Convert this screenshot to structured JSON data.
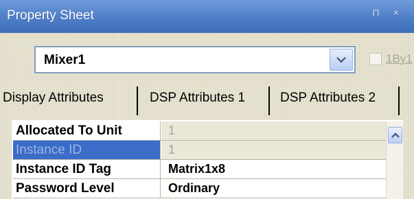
{
  "window": {
    "title": "Property Sheet",
    "title_buttons": [
      "⊓",
      "×"
    ]
  },
  "object_selector": {
    "value": "Mixer1",
    "dropdown_icon": "chevron-down-icon"
  },
  "one_by_one": {
    "label": "1By1",
    "checked": false,
    "enabled": false
  },
  "tabs": [
    {
      "label": "Display Attributes"
    },
    {
      "label": "DSP Attributes 1"
    },
    {
      "label": "DSP Attributes 2"
    }
  ],
  "properties": [
    {
      "name": "Allocated To Unit",
      "value": "1",
      "state": "readonly"
    },
    {
      "name": "Instance ID",
      "value": "1",
      "state": "selected-readonly"
    },
    {
      "name": "Instance ID Tag",
      "value": "Matrix1x8",
      "state": "normal"
    },
    {
      "name": "Password Level",
      "value": "Ordinary",
      "state": "normal"
    }
  ],
  "colors": {
    "titlebar": "#4f7ec8",
    "selection": "#3a6cc8",
    "panel": "#ece9d8"
  }
}
